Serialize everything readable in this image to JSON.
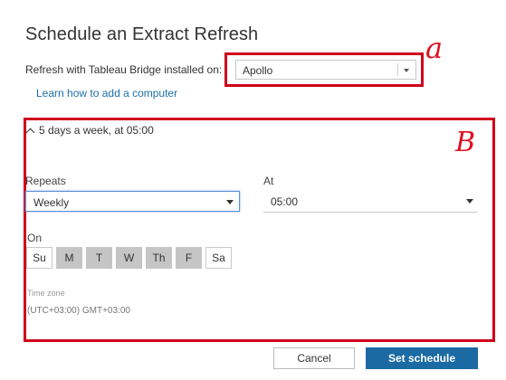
{
  "dialog": {
    "title": "Schedule an Extract Refresh"
  },
  "bridge": {
    "label": "Refresh with Tableau Bridge installed on:",
    "selected": "Apollo",
    "help_link": "Learn how to add a computer"
  },
  "annotations": {
    "a": "a",
    "b": "B",
    "color": "#d0021b"
  },
  "schedule": {
    "summary": "5 days a week, at 05:00",
    "repeats_label": "Repeats",
    "repeats_value": "Weekly",
    "at_label": "At",
    "at_value": "05:00",
    "on_label": "On",
    "days": [
      {
        "label": "Su",
        "selected": false
      },
      {
        "label": "M",
        "selected": true
      },
      {
        "label": "T",
        "selected": true
      },
      {
        "label": "W",
        "selected": true
      },
      {
        "label": "Th",
        "selected": true
      },
      {
        "label": "F",
        "selected": true
      },
      {
        "label": "Sa",
        "selected": false
      }
    ],
    "timezone_label": "Time zone",
    "timezone_value": "(UTC+03:00) GMT+03:00"
  },
  "buttons": {
    "cancel": "Cancel",
    "set": "Set schedule"
  },
  "colors": {
    "accent": "#1b6aa3",
    "link": "#1f6fa5",
    "day_selected": "#c5c5c5",
    "focus": "#5a8fd6"
  }
}
